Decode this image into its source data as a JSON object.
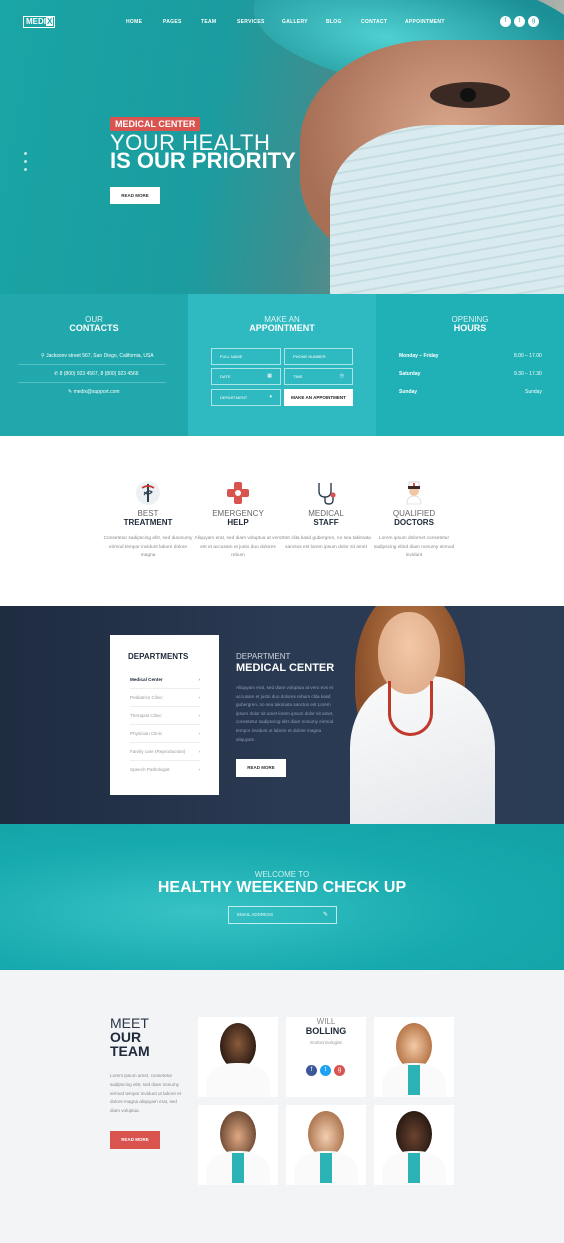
{
  "brand": {
    "logo_a": "MEDI",
    "logo_b": "X"
  },
  "nav": [
    "HOME",
    "PAGES",
    "TEAM",
    "SERVICES",
    "GALLERY",
    "BLOG",
    "CONTACT",
    "APPOINTMENT"
  ],
  "social": [
    "f",
    "t",
    "g"
  ],
  "hero": {
    "badge": "MEDICAL CENTER",
    "line1": "YOUR HEALTH",
    "line2": "IS OUR PRIORITY",
    "button": "READ MORE"
  },
  "contacts": {
    "thin": "OUR",
    "bold": "CONTACTS",
    "address": "Jacksonv street 567, San Diego, California, USA",
    "phone": "8 (800) 923 4567, 8 (800) 923 4566",
    "email": "medix@support.com"
  },
  "appointment": {
    "thin": "MAKE AN",
    "bold": "APPOINTMENT",
    "full_name": "FULL NAME",
    "phone_number": "PHONE NUMBER",
    "date": "DATE",
    "time": "TIME",
    "department": "DEPARTMENT",
    "submit": "MAKE AN APPOINTMENT"
  },
  "hours": {
    "thin": "OPENING",
    "bold": "HOURS",
    "rows": [
      {
        "day": "Monday – Friday",
        "time": "8.00 – 17.00"
      },
      {
        "day": "Saturday",
        "time": "9.30 – 17.30"
      },
      {
        "day": "Sunday",
        "time": "Sunday"
      }
    ]
  },
  "features": [
    {
      "icon": "caduceus-icon",
      "thin": "BEST",
      "bold": "TREATMENT",
      "text": "Consetetur sadipscing elitr, sed diaonumy eirmod tempor invidunt labore dolore magna"
    },
    {
      "icon": "medical-cross-icon",
      "thin": "EMERGENCY",
      "bold": "HELP",
      "text": "Aliquyam erat, sed diam voluptua at vero est et accusam et justo duo dolores rebum"
    },
    {
      "icon": "stethoscope-icon",
      "thin": "MEDICAL",
      "bold": "STAFF",
      "text": "Stet clita kasd gubergren, no sea takimata sanctus est lorem ipsum dolor sit amet"
    },
    {
      "icon": "nurse-icon",
      "thin": "QUALIFIED",
      "bold": "DOCTORS",
      "text": "Lorem ipsum dolornet consetetur sadipscing elitrd diam nonumy eirmod invidunt"
    }
  ],
  "departments": {
    "title": "DEPARTMENTS",
    "items": [
      "Medical Center",
      "Pediatrics Clinic",
      "Therapist Clinic",
      "Physician Clinic",
      "Family care (Reproduction)",
      "Speech Pathologist"
    ],
    "thin": "DEPARTMENT",
    "bold": "MEDICAL CENTER",
    "text": "Aliquyam erat, sed diam voluptua at vero eos et accusam et justo duo dolores rebum clita kasd gubergren, no sea takimata sanctus est Lorem ipsum dolor sit amet lorem ipsum dolor sit amet, consetetur sadipscing elitr diam nonumy eirmod tempor invidunt ut labore et dolore magna aliquyam.",
    "button": "READ MORE"
  },
  "checkup": {
    "thin": "WELCOME TO",
    "bold": "HEALTHY WEEKEND CHECK UP",
    "email_placeholder": "EMAIL ADDRESS"
  },
  "team": {
    "thin": "MEET",
    "bold1": "OUR",
    "bold2": "TEAM",
    "text": "Lorem ipsum amet, consetetur sadipscing elitr, sed diam nonumy eirmod tempor invidunt ut labore et dolore magna aliquyam erat, sed diam voluptua.",
    "button": "READ MORE",
    "featured": {
      "first": "WILL",
      "last": "BOLLING",
      "role": "Endocrinologist"
    }
  },
  "colors": {
    "teal": "#1aa5a5",
    "navy": "#1e2b40",
    "red": "#d9534f"
  }
}
